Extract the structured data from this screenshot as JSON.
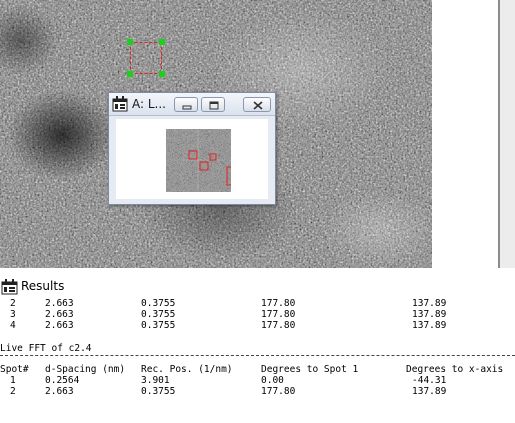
{
  "fft_window": {
    "title": "A: L..."
  },
  "results": {
    "title": "Results",
    "top_rows": [
      [
        "2",
        "2.663",
        "0.3755",
        "177.80",
        "137.89"
      ],
      [
        "3",
        "2.663",
        "0.3755",
        "177.80",
        "137.89"
      ],
      [
        "4",
        "2.663",
        "0.3755",
        "177.80",
        "137.89"
      ]
    ],
    "section_title": "Live FFT of c2.4",
    "columns": [
      "Spot#",
      "d-Spacing (nm)",
      "Rec. Pos. (1/nm)",
      "Degrees to Spot 1",
      "Degrees to x-axis"
    ],
    "rows": [
      [
        "1",
        "0.2564",
        "3.901",
        "0.00",
        "-44.31"
      ],
      [
        "2",
        "2.663",
        "0.3755",
        "177.80",
        "137.89"
      ]
    ]
  },
  "colors": {
    "roi_dashed": "#e02020",
    "roi_handles": "#19d219",
    "fft_markers": "#e02020"
  },
  "icons": {
    "fft_app": "app-window-icon",
    "results": "results-window-icon",
    "minimize": "minimize-icon",
    "maximize": "maximize-icon",
    "close": "close-icon"
  }
}
